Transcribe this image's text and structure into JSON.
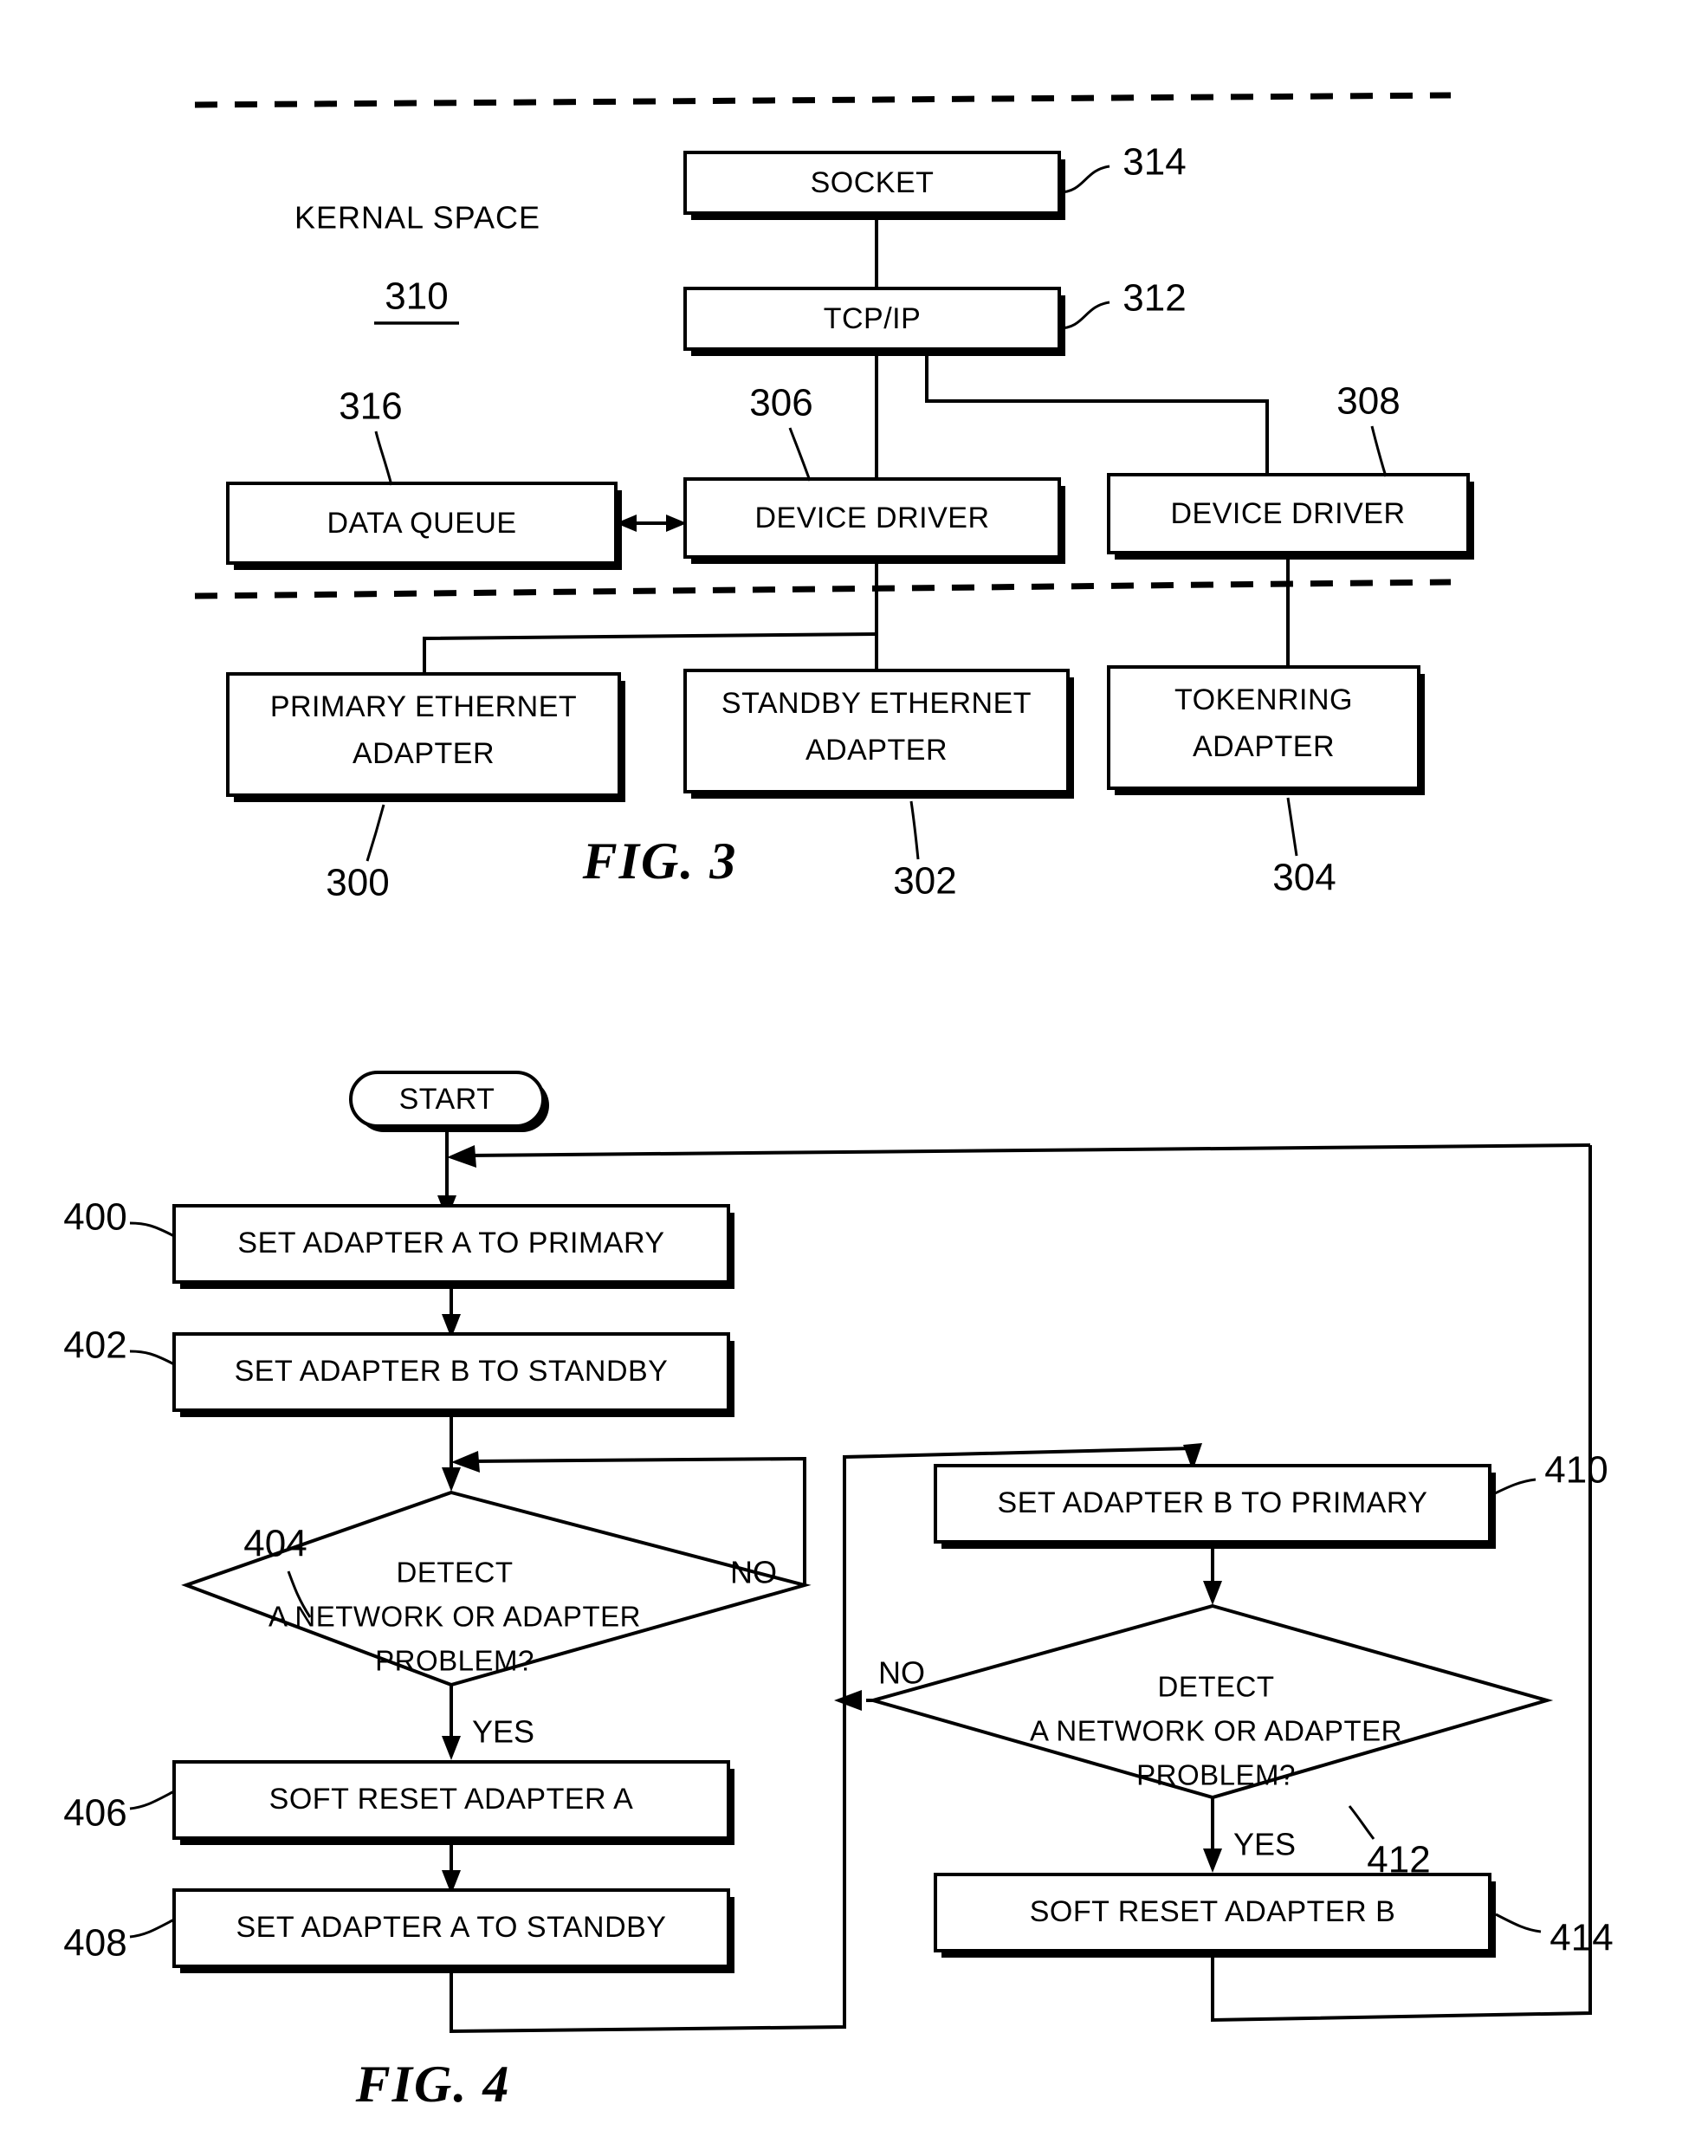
{
  "figure3": {
    "caption": "FIG. 3",
    "space_label": "KERNAL SPACE",
    "space_ref": "310",
    "boxes": {
      "socket": {
        "label": "SOCKET",
        "ref": "314"
      },
      "tcpip": {
        "label": "TCP/IP",
        "ref": "312"
      },
      "data_queue": {
        "label": "DATA QUEUE",
        "ref": "316"
      },
      "device_driver_1": {
        "label": "DEVICE DRIVER",
        "ref": "306"
      },
      "device_driver_2": {
        "label": "DEVICE DRIVER",
        "ref": "308"
      },
      "primary_ethernet": {
        "label_line1": "PRIMARY ETHERNET",
        "label_line2": "ADAPTER",
        "ref": "300"
      },
      "standby_ethernet": {
        "label_line1": "STANDBY ETHERNET",
        "label_line2": "ADAPTER",
        "ref": "302"
      },
      "tokenring": {
        "label_line1": "TOKENRING",
        "label_line2": "ADAPTER",
        "ref": "304"
      }
    }
  },
  "figure4": {
    "caption": "FIG. 4",
    "start": {
      "label": "START"
    },
    "steps": {
      "s400": {
        "label": "SET ADAPTER A TO PRIMARY",
        "ref": "400"
      },
      "s402": {
        "label": "SET ADAPTER B TO STANDBY",
        "ref": "402"
      },
      "s404": {
        "line1": "DETECT",
        "line2": "A NETWORK OR ADAPTER",
        "line3": "PROBLEM?",
        "ref": "404",
        "yes_label": "YES",
        "no_label": "NO"
      },
      "s406": {
        "label": "SOFT RESET ADAPTER A",
        "ref": "406"
      },
      "s408": {
        "label": "SET ADAPTER A TO STANDBY",
        "ref": "408"
      },
      "s410": {
        "label": "SET ADAPTER B TO PRIMARY",
        "ref": "410"
      },
      "s412": {
        "line1": "DETECT",
        "line2": "A NETWORK OR ADAPTER",
        "line3": "PROBLEM?",
        "ref": "412",
        "yes_label": "YES",
        "no_label": "NO"
      },
      "s414": {
        "label": "SOFT RESET ADAPTER B",
        "ref": "414"
      }
    }
  },
  "colors": {
    "ink": "#000000",
    "paper": "#ffffff"
  }
}
